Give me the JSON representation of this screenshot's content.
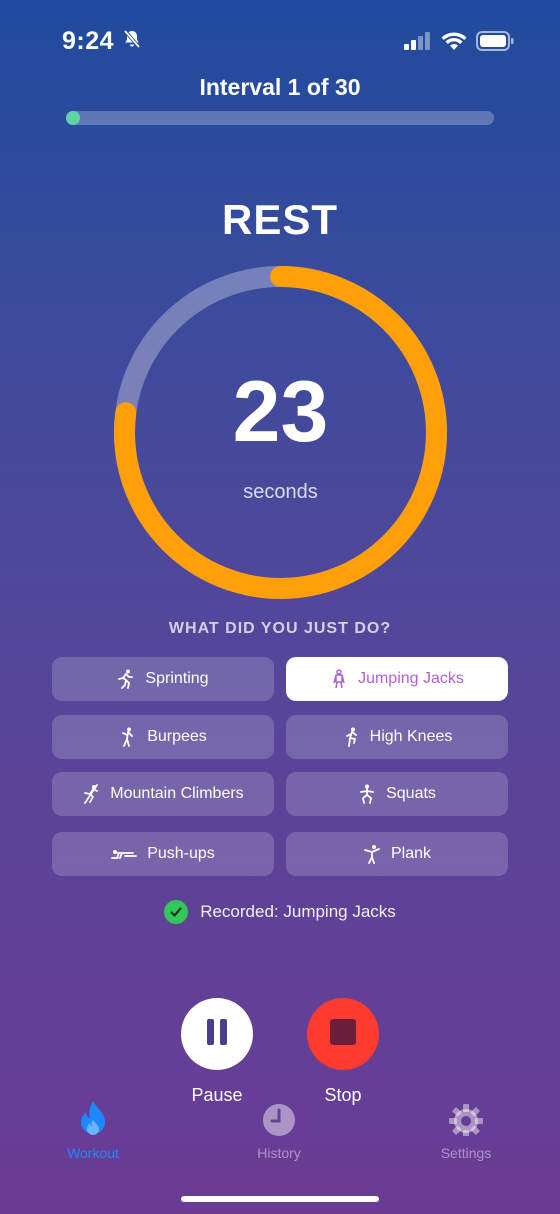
{
  "status_bar": {
    "time": "9:24"
  },
  "header": {
    "interval_label": "Interval 1 of 30",
    "progress_fraction": 0.0333
  },
  "timer": {
    "phase": "REST",
    "remaining": "23",
    "unit": "seconds",
    "ring_fraction": 0.77
  },
  "question": "WHAT DID YOU JUST DO?",
  "exercises": [
    {
      "label": "Sprinting",
      "icon": "running-icon",
      "selected": false
    },
    {
      "label": "Jumping Jacks",
      "icon": "jumping-jacks-icon",
      "selected": true
    },
    {
      "label": "Burpees",
      "icon": "burpee-icon",
      "selected": false
    },
    {
      "label": "High Knees",
      "icon": "high-knees-icon",
      "selected": false
    },
    {
      "label": "Mountain Climbers",
      "icon": "mountain-climber-icon",
      "selected": false
    },
    {
      "label": "Squats",
      "icon": "squat-icon",
      "selected": false
    },
    {
      "label": "Push-ups",
      "icon": "push-up-icon",
      "selected": false
    },
    {
      "label": "Plank",
      "icon": "plank-icon",
      "selected": false
    }
  ],
  "recorded": {
    "text": "Recorded: Jumping Jacks"
  },
  "controls": {
    "pause_label": "Pause",
    "stop_label": "Stop"
  },
  "tabs": [
    {
      "label": "Workout",
      "icon": "flame-icon",
      "active": true
    },
    {
      "label": "History",
      "icon": "clock-icon",
      "active": false
    },
    {
      "label": "Settings",
      "icon": "gear-icon",
      "active": false
    }
  ],
  "colors": {
    "accent_orange": "#ff9f0a",
    "progress_green": "#5ed3a8",
    "stop_red": "#ff3b30",
    "check_green": "#34c759",
    "selected_text": "#b35fd6",
    "tab_active": "#1e88ff"
  }
}
